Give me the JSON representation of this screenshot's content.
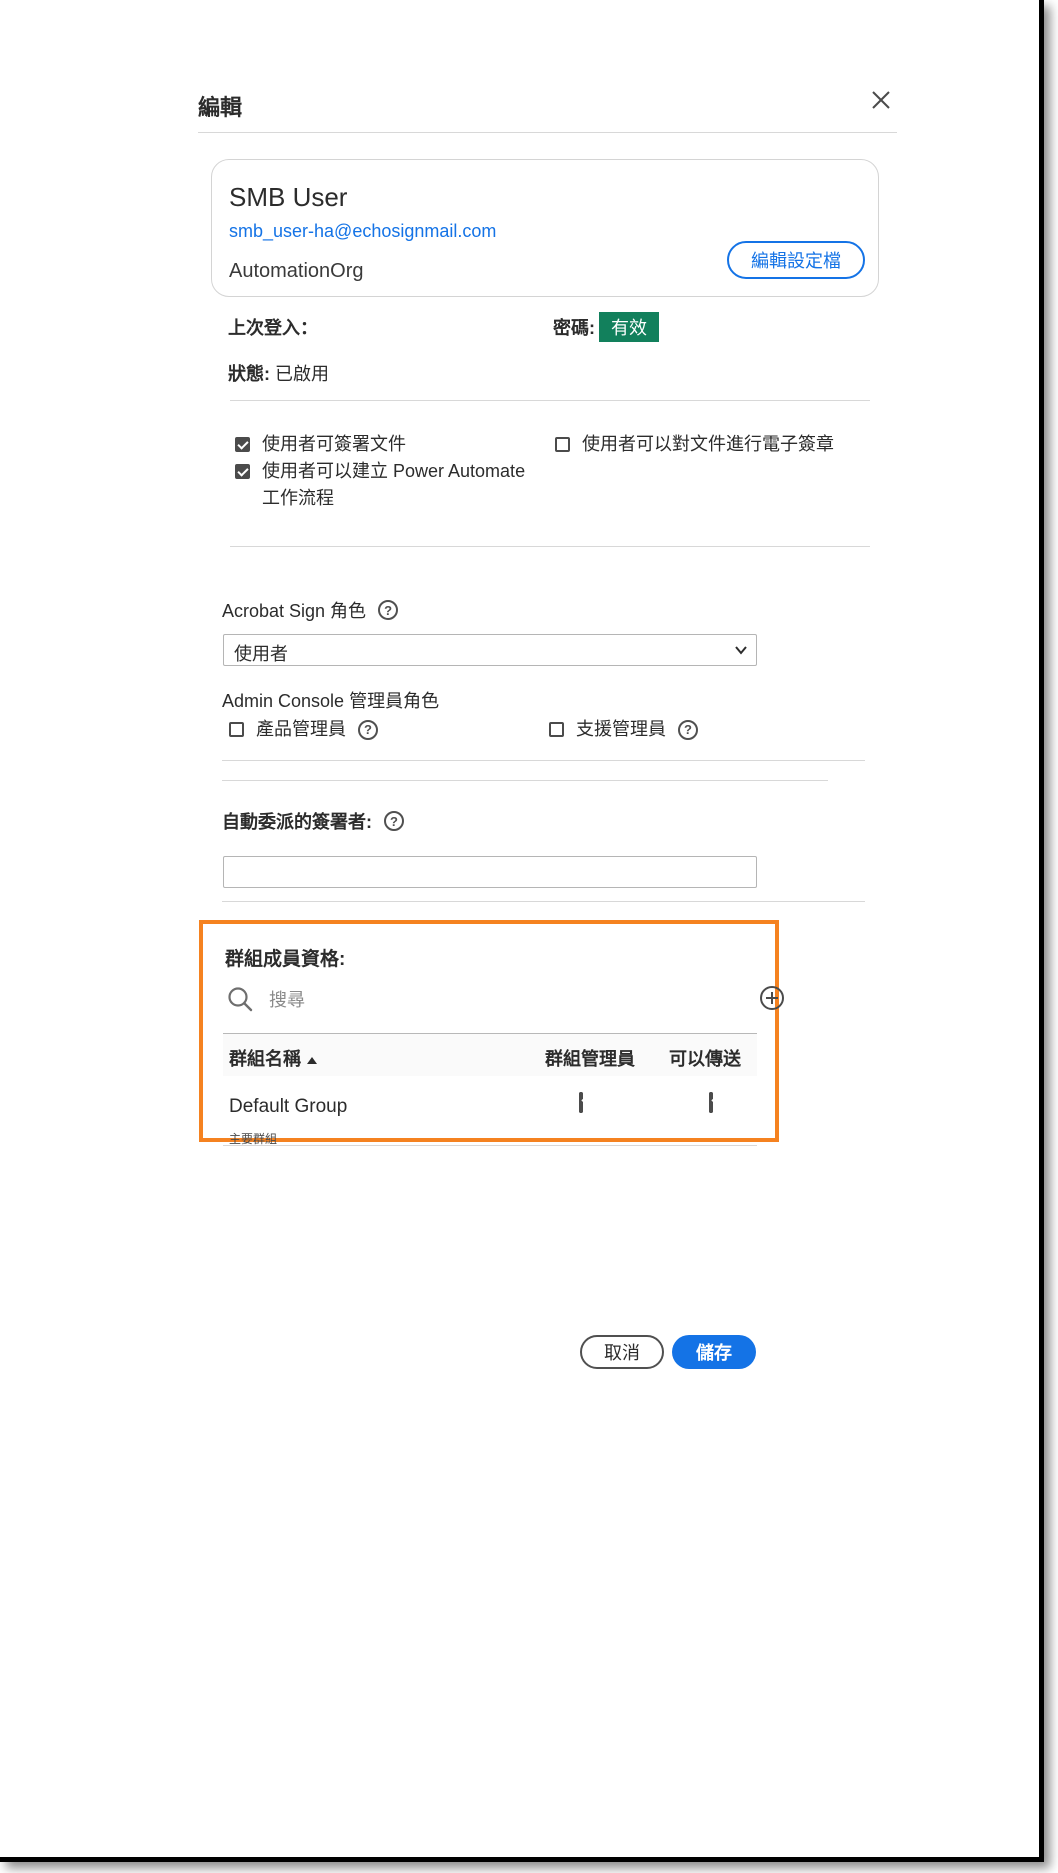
{
  "dialog": {
    "title": "編輯",
    "close_icon": "close-icon"
  },
  "user": {
    "name": "SMB User",
    "email": "smb_user-ha@echosignmail.com",
    "org": "AutomationOrg",
    "edit_profile_label": "編輯設定檔"
  },
  "info": {
    "last_login_label": "上次登入：",
    "password_label": "密碼:",
    "password_status": "有效",
    "status_label": "狀態:",
    "status_value": "已啟用"
  },
  "permissions": [
    {
      "label": "使用者可簽署文件",
      "checked": true
    },
    {
      "label": "使用者可以對文件進行電子簽章",
      "checked": false
    },
    {
      "label_line1": "使用者可以建立 Power Automate",
      "label_line2": "工作流程",
      "checked": true
    }
  ],
  "acrobat_role": {
    "label": "Acrobat Sign 角色",
    "selected": "使用者"
  },
  "admin_console": {
    "label": "Admin Console 管理員角色",
    "options": [
      {
        "label": "產品管理員",
        "checked": false
      },
      {
        "label": "支援管理員",
        "checked": false
      }
    ]
  },
  "delegate": {
    "label": "自動委派的簽署者:",
    "value": ""
  },
  "groups": {
    "label": "群組成員資格:",
    "search_placeholder": "搜尋",
    "columns": [
      "群組名稱",
      "群組管理員",
      "可以傳送"
    ],
    "rows": [
      {
        "name": "Default Group",
        "sub": "主要群組",
        "is_admin": true,
        "can_send": true
      }
    ]
  },
  "footer": {
    "cancel_label": "取消",
    "save_label": "儲存"
  },
  "colors": {
    "accent": "#1473e6",
    "badge": "#12805c",
    "highlight": "#f58220"
  }
}
